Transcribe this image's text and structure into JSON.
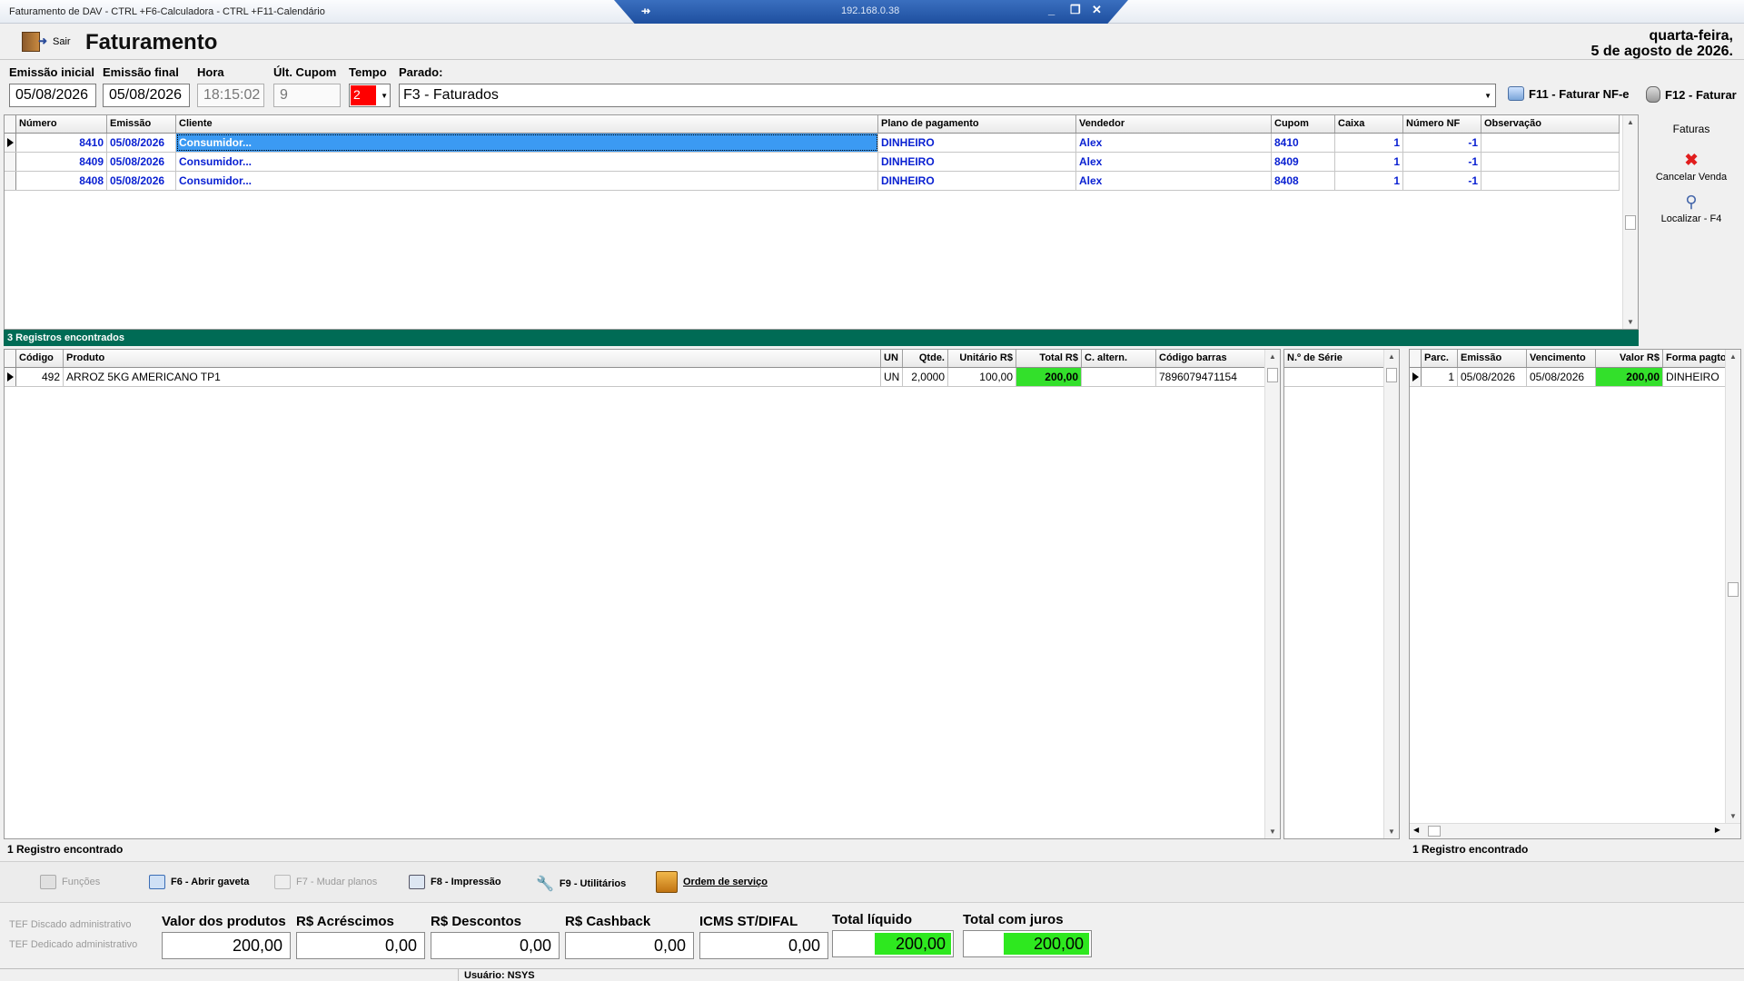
{
  "window": {
    "title": "Faturamento de DAV -  CTRL +F6-Calculadora - CTRL +F11-Calendário",
    "remote_ip": "192.168.0.38"
  },
  "header": {
    "exit_label": "Sair",
    "title": "Faturamento",
    "date_weekday": "quarta-feira,",
    "date_full": "5 de agosto de 2026."
  },
  "filters": {
    "emissao_inicial_label": "Emissão inicial",
    "emissao_inicial": "05/08/2026",
    "emissao_final_label": "Emissão final",
    "emissao_final": "05/08/2026",
    "hora_label": "Hora",
    "hora": "18:15:02",
    "ult_cupom_label": "Últ. Cupom",
    "ult_cupom": "9",
    "tempo_label": "Tempo",
    "tempo": "2",
    "parado_label": "Parado:",
    "parado": "F3 - Faturados"
  },
  "actions": {
    "f11": "F11 - Faturar NF-e",
    "f12": "F12 - Faturar"
  },
  "faturas": {
    "title": "Faturas",
    "cancel": "Cancelar Venda",
    "find": "Localizar - F4"
  },
  "orders": {
    "columns": [
      "Número",
      "Emissão",
      "Cliente",
      "Plano de pagamento",
      "Vendedor",
      "Cupom",
      "Caixa",
      "Número NF",
      "Observação"
    ],
    "rows": [
      {
        "numero": "8410",
        "emissao": "05/08/2026",
        "cliente": "Consumidor...",
        "plano": "DINHEIRO",
        "vendedor": "Alex",
        "cupom": "8410",
        "caixa": "1",
        "nf": "-1",
        "obs": ""
      },
      {
        "numero": "8409",
        "emissao": "05/08/2026",
        "cliente": "Consumidor...",
        "plano": "DINHEIRO",
        "vendedor": "Alex",
        "cupom": "8409",
        "caixa": "1",
        "nf": "-1",
        "obs": ""
      },
      {
        "numero": "8408",
        "emissao": "05/08/2026",
        "cliente": "Consumidor...",
        "plano": "DINHEIRO",
        "vendedor": "Alex",
        "cupom": "8408",
        "caixa": "1",
        "nf": "-1",
        "obs": ""
      }
    ],
    "status": "3 Registros encontrados"
  },
  "items": {
    "columns": [
      "Código",
      "Produto",
      "UN",
      "Qtde.",
      "Unitário R$",
      "Total R$",
      "C. altern.",
      "Código barras"
    ],
    "rows": [
      {
        "codigo": "492",
        "produto": "ARROZ 5KG AMERICANO TP1",
        "un": "UN",
        "qtde": "2,0000",
        "unitario": "100,00",
        "total": "200,00",
        "calt": "",
        "barras": "7896079471154"
      }
    ],
    "serie_header": "N.º de Série",
    "status": "1 Registro encontrado"
  },
  "parcels": {
    "columns": [
      "Parc.",
      "Emissão",
      "Vencimento",
      "Valor R$",
      "Forma pagto"
    ],
    "rows": [
      {
        "parc": "1",
        "emissao": "05/08/2026",
        "vencimento": "05/08/2026",
        "valor": "200,00",
        "forma": "DINHEIRO"
      }
    ],
    "status": "1 Registro encontrado"
  },
  "toolbar": {
    "funcoes": "Funções",
    "f6": "F6 - Abrir gaveta",
    "f7": "F7 - Mudar planos",
    "f8": "F8 - Impressão",
    "f9": "F9 - Utilitários",
    "os": "Ordem de serviço"
  },
  "tef": {
    "discado": "TEF Discado administrativo",
    "dedicado": "TEF Dedicado administrativo"
  },
  "totals": {
    "produtos_label": "Valor dos produtos",
    "produtos": "200,00",
    "acrescimos_label": "R$ Acréscimos",
    "acrescimos": "0,00",
    "descontos_label": "R$ Descontos",
    "descontos": "0,00",
    "cashback_label": "R$ Cashback",
    "cashback": "0,00",
    "icms_label": "ICMS ST/DIFAL",
    "icms": "0,00",
    "liquido_label": "Total líquido",
    "liquido": "200,00",
    "juros_label": "Total com juros",
    "juros": "200,00"
  },
  "footer": {
    "user": "Usuário: NSYS"
  }
}
